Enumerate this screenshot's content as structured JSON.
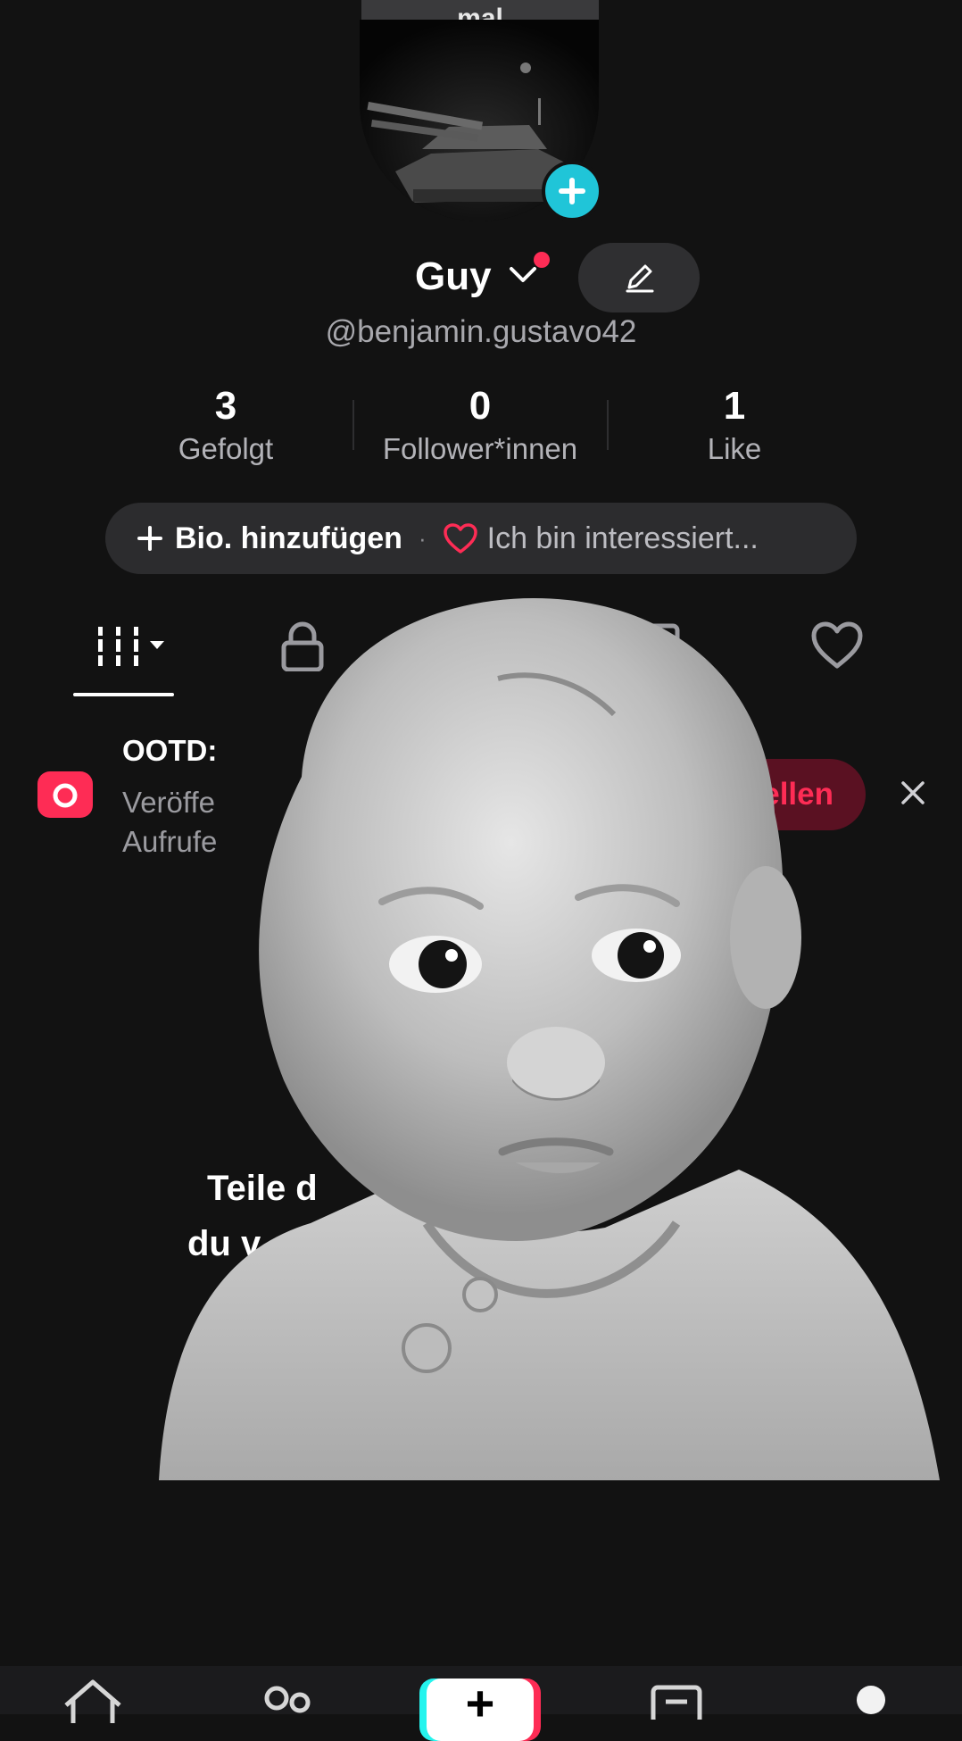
{
  "tooltip": {
    "text": "mal"
  },
  "profile": {
    "name": "Guy",
    "handle": "@benjamin.gustavo42"
  },
  "stats": [
    {
      "value": "3",
      "label": "Gefolgt"
    },
    {
      "value": "0",
      "label": "Follower*innen"
    },
    {
      "value": "1",
      "label": "Like"
    }
  ],
  "bio": {
    "add_label": "Bio. hinzufügen",
    "separator": "·",
    "interest_label": "Ich bin interessiert..."
  },
  "tabs": [
    "videos-grid-icon",
    "lock-icon",
    "bookmark-icon",
    "heart-icon"
  ],
  "ootd": {
    "title": "OOTD:",
    "body_line1": "Veröffe",
    "body_line2": "Aufrufe",
    "button_label": "stellen"
  },
  "empty_state": {
    "line1": "Teile d",
    "line2": "du v"
  },
  "nav": {
    "items": [
      "home-icon",
      "friends-icon",
      "create-icon",
      "inbox-icon",
      "profile-icon"
    ],
    "create_label": "+"
  },
  "colors": {
    "background": "#121212",
    "accent": "#fe2c55",
    "add_badge": "#20c5d8"
  }
}
